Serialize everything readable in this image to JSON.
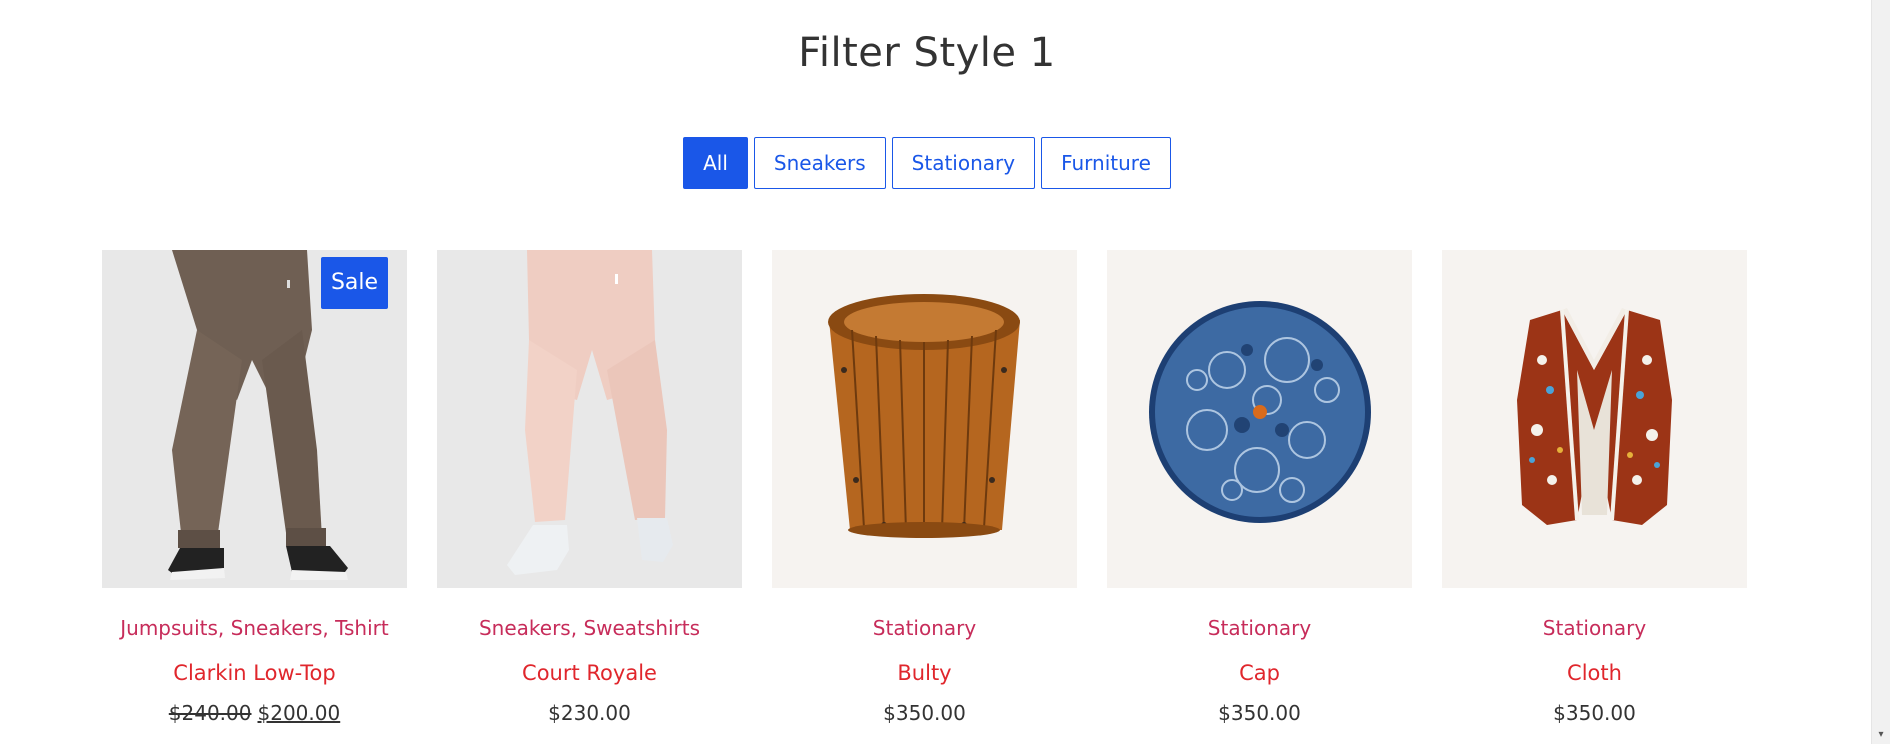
{
  "section_title": "Filter Style 1",
  "filters": [
    "All",
    "Sneakers",
    "Stationary",
    "Furniture"
  ],
  "active_filter": "All",
  "accent_color": "#1a57e8",
  "category_color": "#c72c5a",
  "name_color": "#e0262c",
  "products": [
    {
      "categories": [
        "Jumpsuits",
        "Sneakers",
        "Tshirt"
      ],
      "name": "Clarkin Low-Top",
      "badge": "Sale",
      "old_price": "$240.00",
      "price": "$200.00",
      "image": "brown-joggers"
    },
    {
      "categories": [
        "Sneakers",
        "Sweatshirts"
      ],
      "name": "Court Royale",
      "price": "$230.00",
      "image": "pink-leggings"
    },
    {
      "categories": [
        "Stationary"
      ],
      "name": "Bulty",
      "price": "$350.00",
      "image": "wooden-basket"
    },
    {
      "categories": [
        "Stationary"
      ],
      "name": "Cap",
      "price": "$350.00",
      "image": "blue-patterned-plate"
    },
    {
      "categories": [
        "Stationary"
      ],
      "name": "Cloth",
      "price": "$350.00",
      "image": "ceramic-vest"
    }
  ]
}
